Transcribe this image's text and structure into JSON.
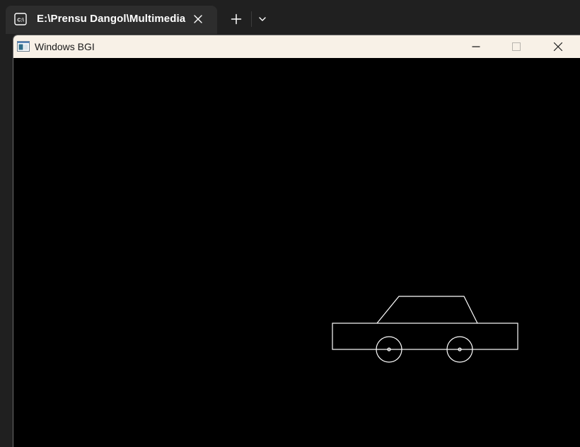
{
  "terminal": {
    "tab_title": "E:\\Prensu Dangol\\Multimedia",
    "tab_icon": "console-icon",
    "new_tab_icon": "plus-icon",
    "dropdown_icon": "chevron-down-icon",
    "close_icon": "close-icon"
  },
  "bgi_window": {
    "title": "Windows BGI",
    "app_icon": "window-app-icon",
    "minimize_icon": "minimize-icon",
    "maximize_icon": "maximize-icon",
    "close_icon": "close-icon",
    "background_color": "#000000",
    "drawing_color": "#ffffff",
    "drawing": "car"
  }
}
